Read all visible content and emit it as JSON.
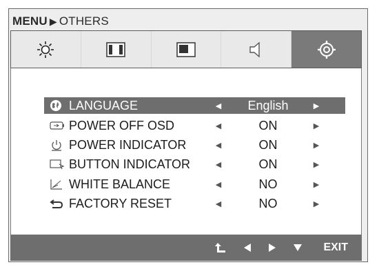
{
  "breadcrumb": {
    "menu": "MENU",
    "section": "OTHERS"
  },
  "tabs": [
    {
      "name": "picture",
      "icon": "brightness-icon"
    },
    {
      "name": "color",
      "icon": "color-icon"
    },
    {
      "name": "display",
      "icon": "display-icon"
    },
    {
      "name": "audio",
      "icon": "speaker-icon"
    },
    {
      "name": "others",
      "icon": "gear-icon",
      "active": true
    }
  ],
  "items": [
    {
      "label": "LANGUAGE",
      "value": "English",
      "icon": "globe-icon",
      "selected": true
    },
    {
      "label": "POWER OFF OSD",
      "value": "ON",
      "icon": "power-off-osd-icon"
    },
    {
      "label": "POWER INDICATOR",
      "value": "ON",
      "icon": "power-icon"
    },
    {
      "label": "BUTTON INDICATOR",
      "value": "ON",
      "icon": "button-indicator-icon"
    },
    {
      "label": "WHITE BALANCE",
      "value": "NO",
      "icon": "white-balance-icon"
    },
    {
      "label": "FACTORY RESET",
      "value": "NO",
      "icon": "reset-icon"
    }
  ],
  "footer": {
    "exit_label": "EXIT"
  },
  "colors": {
    "panel_bg": "#ffffff",
    "bar_gray": "#6e6e6e",
    "frame_gray": "#eeeeee"
  }
}
